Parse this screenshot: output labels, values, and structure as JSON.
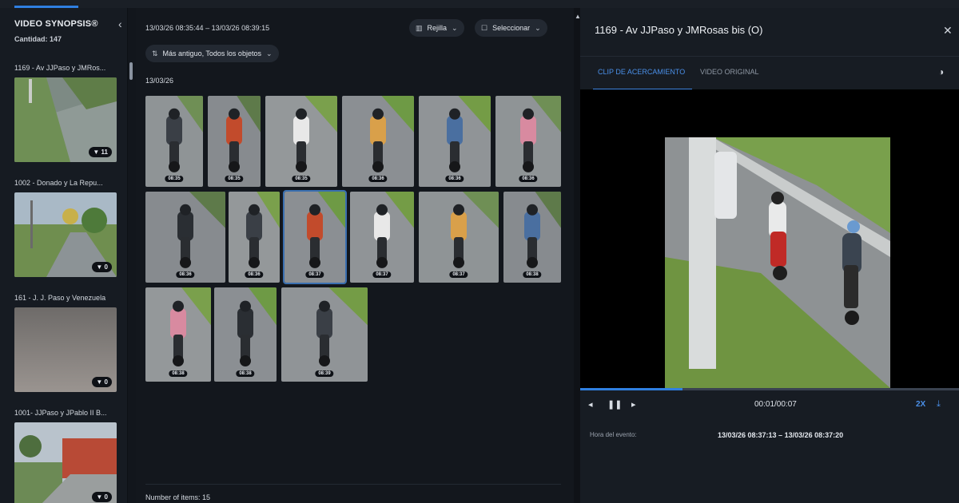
{
  "sidebar": {
    "title": "VIDEO SYNOPSIS®",
    "count_label": "Cantidad: 147",
    "collapse_icon": "chevron-left-icon",
    "cameras": [
      {
        "label": "1169 - Av JJPaso y JMRos...",
        "badge": "▼ 11"
      },
      {
        "label": "1002 - Donado y La Repu...",
        "badge": "▼ 0"
      },
      {
        "label": "161 - J. J. Paso y Venezuela",
        "badge": "▼ 0"
      },
      {
        "label": "1001- JJPaso y JPablo II B...",
        "badge": "▼ 0"
      }
    ]
  },
  "middle": {
    "time_range": "13/03/26 08:35:44  –  13/03/26 08:39:15",
    "view_button": "Rejilla",
    "select_button": "Seleccionar",
    "sort_filter": "Más antiguo, Todos los objetos",
    "date_label": "13/03/26",
    "items_count": "Number of items: 15",
    "tiles": [
      {
        "ts": "08:35"
      },
      {
        "ts": "08:35"
      },
      {
        "ts": "08:35"
      },
      {
        "ts": "08:36"
      },
      {
        "ts": "08:36"
      },
      {
        "ts": "08:36"
      },
      {
        "ts": "08:36"
      },
      {
        "ts": "08:36"
      },
      {
        "ts": "08:37"
      },
      {
        "ts": "08:37"
      },
      {
        "ts": "08:37"
      },
      {
        "ts": "08:38"
      },
      {
        "ts": "08:38"
      },
      {
        "ts": "08:38"
      },
      {
        "ts": "08:39"
      }
    ],
    "selected_tile_index": 8
  },
  "right": {
    "title": "1169 - Av JJPaso y JMRosas bis (O)",
    "tabs": [
      {
        "label": "CLIP DE ACERCAMIENTO",
        "active": true
      },
      {
        "label": "VIDEO ORIGINAL",
        "active": false
      }
    ],
    "time": "00:01/00:07",
    "progress_fraction": 0.27,
    "speed": "2X",
    "event_label": "Hora del evento:",
    "event_value": "13/03/26 08:37:13  –  13/03/26 08:37:20"
  },
  "colors": {
    "accent": "#2f7fe0",
    "background": "#12161c"
  }
}
